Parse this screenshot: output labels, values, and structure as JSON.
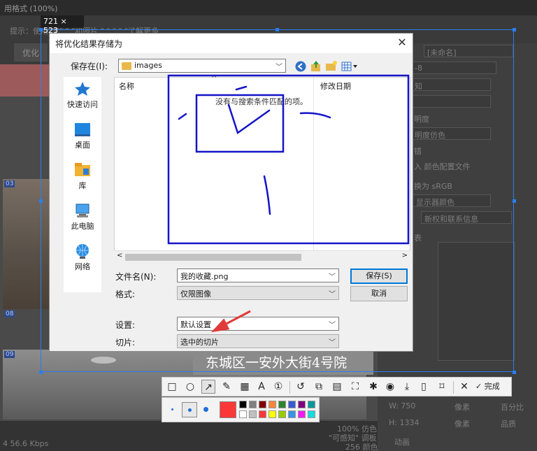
{
  "background": {
    "title": "用格式 (100%)",
    "hint": "提示：使用\"文\"     \"      \"和照片    \"     \"     \"     \"     \"了解更多",
    "tab": "优化",
    "address": "东城区一安外大街4号院",
    "slice_ids": [
      "03",
      "08",
      "09"
    ],
    "right_panel": [
      "[未命名]",
      "-8",
      "知",
      "明度",
      "明度仿色",
      "错",
      "入 颜色配置文件",
      "换为 sRGB",
      "显示器颜色",
      "新权和联系信息",
      "表",
      "W: 750",
      "H: 1334",
      "像素",
      "百分比",
      "品质",
      "动画"
    ],
    "status": [
      "100% 仿色",
      "\"可感知\"  调板",
      "256  颜色"
    ],
    "bottom_left": "4 56.6 Kbps"
  },
  "capture": {
    "size_label": "721 × 523"
  },
  "dialog": {
    "title": "将优化结果存储为",
    "close_label": "✕",
    "save_in_label": "保存在(I):",
    "folder": "images",
    "nav": [
      "快速访问",
      "桌面",
      "库",
      "此电脑",
      "网络"
    ],
    "columns": [
      "名称",
      "修改日期"
    ],
    "empty_message": "没有与搜索条件匹配的项。",
    "filename_label": "文件名(N):",
    "filename_value": "我的收藏.png",
    "format_label": "格式:",
    "format_value": "仅限图像",
    "settings_label": "设置:",
    "settings_value": "默认设置",
    "slices_label": "切片:",
    "slices_value": "选中的切片",
    "save_button": "保存(S)",
    "cancel_button": "取消"
  },
  "toolbar": {
    "done_label": "完成",
    "colors": [
      "#000000",
      "#808080",
      "#800000",
      "#f7883a",
      "#308430",
      "#385ad3",
      "#800080",
      "#009999",
      "#ffffff",
      "#c0c0c0",
      "#fb3838",
      "#ffff00",
      "#99cc00",
      "#3894e4",
      "#f31bf3",
      "#16dcdc"
    ],
    "current_color": "#fb3838",
    "annotation_color": "#1414c8"
  }
}
